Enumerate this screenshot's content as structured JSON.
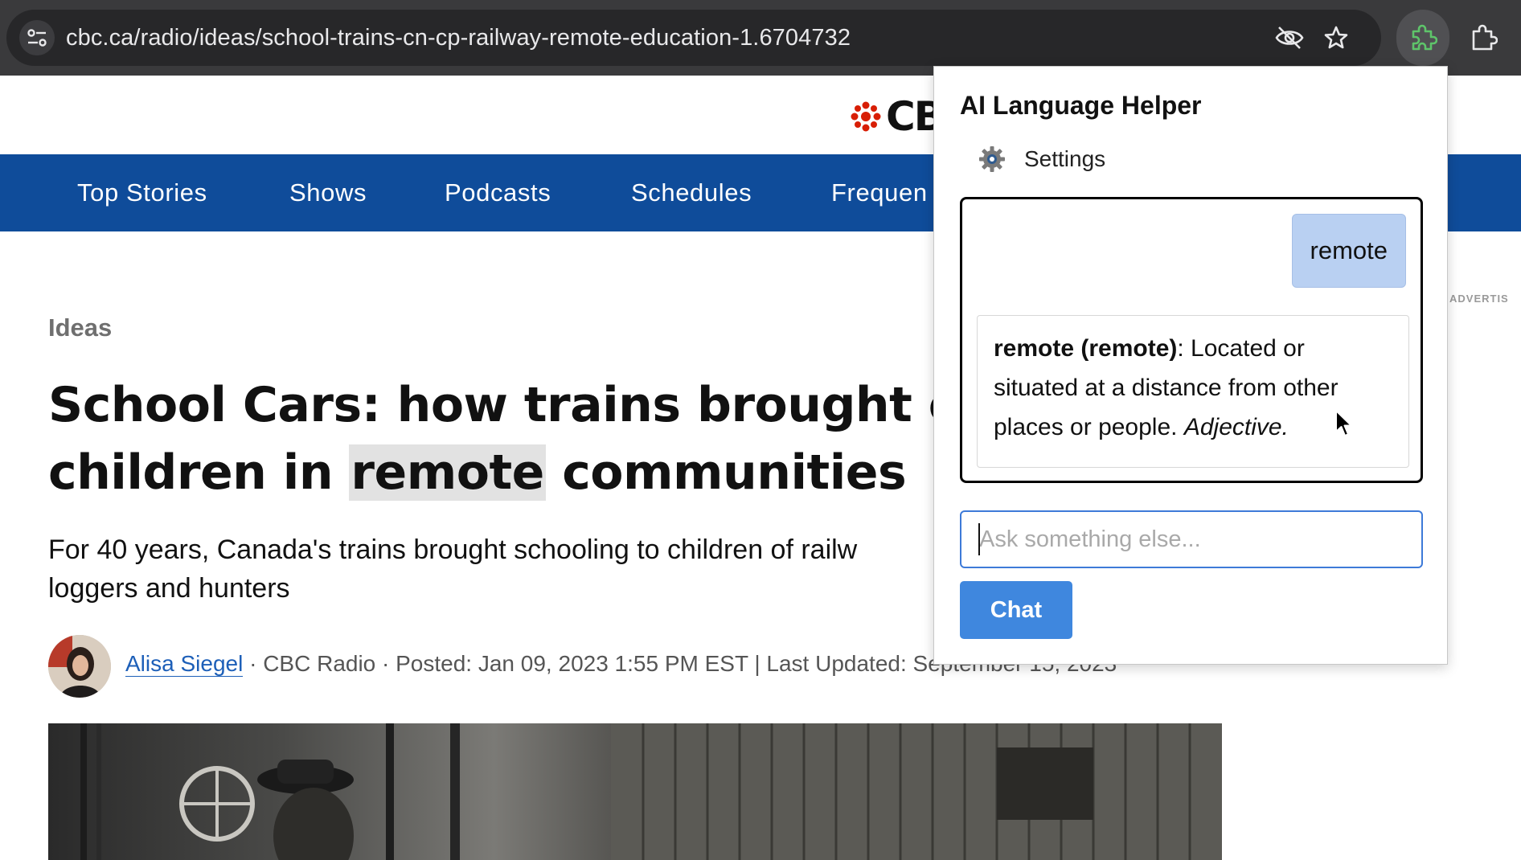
{
  "browser": {
    "url": "cbc.ca/radio/ideas/school-trains-cn-cp-railway-remote-education-1.6704732",
    "icons": [
      "tune-icon",
      "eye-off-icon",
      "star-icon",
      "puzzle-icon",
      "extensions-icon"
    ],
    "accent_color": "#5ec46a"
  },
  "site": {
    "logo_text": "CB",
    "nav": [
      "Top Stories",
      "Shows",
      "Podcasts",
      "Schedules",
      "Frequen"
    ],
    "ad_label": "ADVERTIS",
    "brand_color": "#0f4c9a"
  },
  "article": {
    "section": "Ideas",
    "headline_part1": "School Cars: how trains brought clas",
    "headline_part2": "children in ",
    "headline_highlight": "remote",
    "headline_part3": " communities",
    "dek_line1": "For 40 years, Canada's trains brought schooling to children of railw",
    "dek_line2": "loggers and hunters",
    "author": "Alisa Siegel",
    "meta": " · CBC Radio · Posted: Jan 09, 2023 1:55 PM EST | Last Updated: Se",
    "meta_obscured": "ptember 15, 2023"
  },
  "popup": {
    "title": "AI Language Helper",
    "settings_label": "Settings",
    "user_message": "remote",
    "answer_term": "remote (remote)",
    "answer_body": ": Located or situated at a distance from other places or people. ",
    "answer_pos": "Adjective.",
    "input_placeholder": "Ask something else...",
    "chat_button": "Chat"
  }
}
